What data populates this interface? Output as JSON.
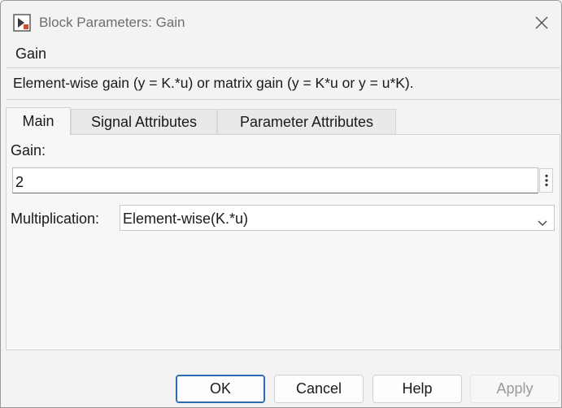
{
  "window": {
    "title": "Block Parameters: Gain"
  },
  "header": {
    "group_label": "Gain",
    "description": "Element-wise gain (y = K.*u) or matrix gain (y = K*u or y = u*K)."
  },
  "tabs": [
    {
      "label": "Main",
      "active": true
    },
    {
      "label": "Signal Attributes",
      "active": false
    },
    {
      "label": "Parameter Attributes",
      "active": false
    }
  ],
  "main": {
    "gain_label": "Gain:",
    "gain_value": "2",
    "multiplication_label": "Multiplication:",
    "multiplication_value": "Element-wise(K.*u)"
  },
  "buttons": {
    "ok": "OK",
    "cancel": "Cancel",
    "help": "Help",
    "apply": "Apply"
  },
  "icons": {
    "app": "simulink-block-icon",
    "close": "close-icon",
    "options": "kebab-menu-icon",
    "dropdown": "chevron-down-icon"
  },
  "colors": {
    "accent": "#2d6ab4",
    "disabled_text": "#9a9a9a"
  }
}
